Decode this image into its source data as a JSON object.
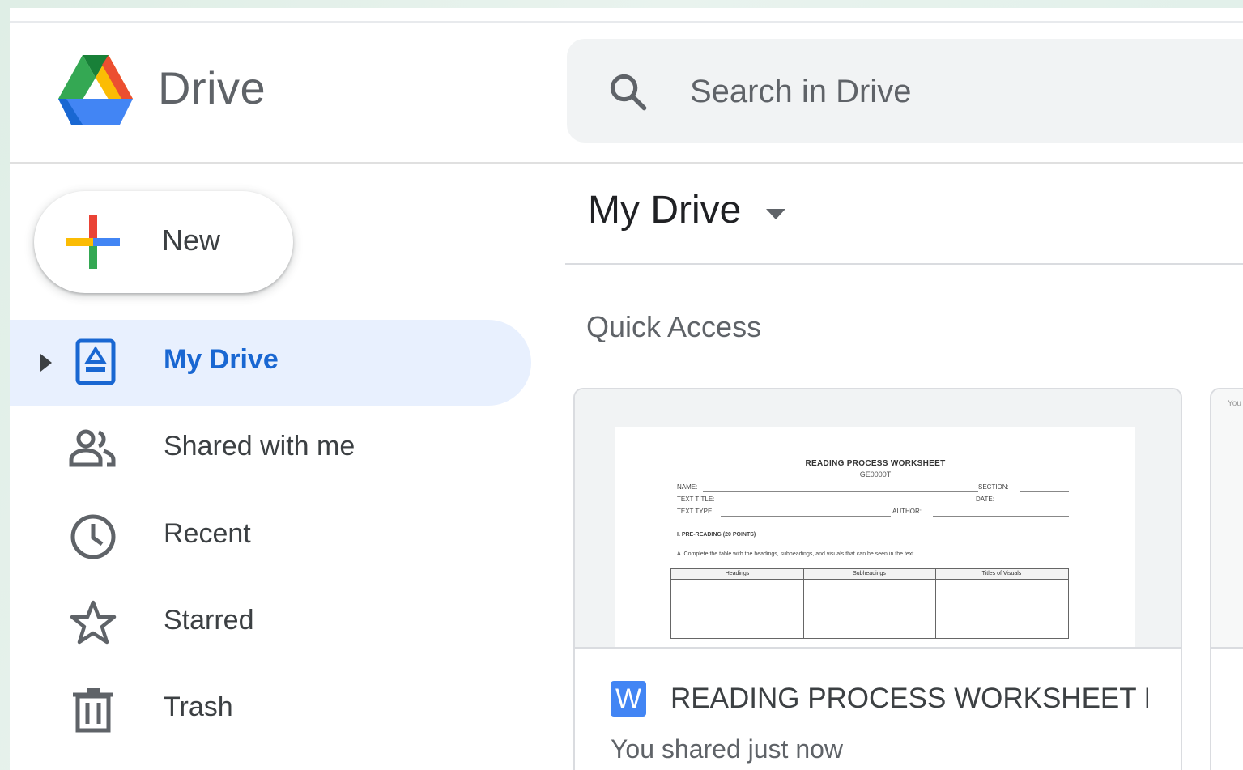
{
  "app": {
    "title": "Drive",
    "logo_icon": "google-drive-logo",
    "brand_colors": {
      "green": "#1e8e3e",
      "blue": "#4285f4",
      "yellow": "#fbbc04",
      "red": "#ea4335"
    }
  },
  "search": {
    "placeholder": "Search in Drive",
    "value": "",
    "icon": "search-icon"
  },
  "sidebar": {
    "new_button": {
      "label": "New",
      "icon": "plus-icon"
    },
    "items": [
      {
        "label": "My Drive",
        "icon": "my-drive-icon",
        "active": true
      },
      {
        "label": "Shared with me",
        "icon": "people-icon",
        "active": false
      },
      {
        "label": "Recent",
        "icon": "clock-icon",
        "active": false
      },
      {
        "label": "Starred",
        "icon": "star-icon",
        "active": false
      },
      {
        "label": "Trash",
        "icon": "trash-icon",
        "active": false
      }
    ],
    "active_color": "#1967d2",
    "active_background": "#e8f0fe"
  },
  "main": {
    "title": "My Drive",
    "section": "Quick Access",
    "quick_access": [
      {
        "file_type_badge": "W",
        "file_type_icon": "word-icon",
        "name": "READING PROCESS WORKSHEET D...",
        "activity": "You shared just now",
        "preview": {
          "title": "READING PROCESS WORKSHEET",
          "code": "GE0000T",
          "name_label": "NAME:",
          "section_label": "SECTION:",
          "text_title_label": "TEXT TITLE:",
          "date_label": "DATE:",
          "text_type_label": "TEXT TYPE:",
          "author_label": "AUTHOR:",
          "part_heading": "I. PRE-READING (20 POINTS)",
          "instruction": "A. Complete the table with the headings, subheadings, and visuals that can be seen in the text.",
          "table_headers": [
            "Headings",
            "Subheadings",
            "Titles of Visuals"
          ]
        }
      }
    ],
    "partial_card_text": "You"
  }
}
